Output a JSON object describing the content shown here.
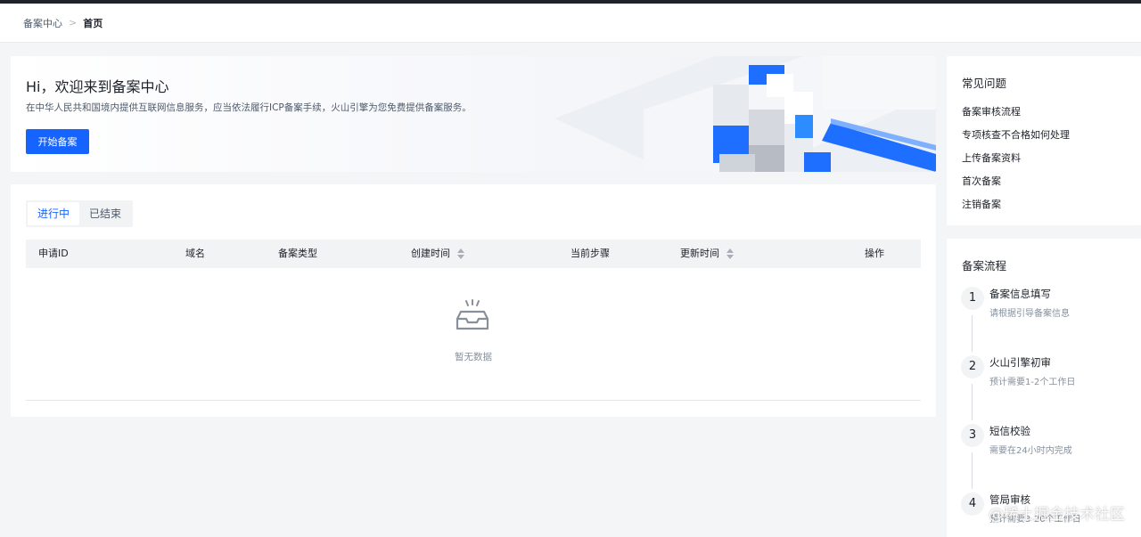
{
  "breadcrumb": {
    "parent": "备案中心",
    "separator": ">",
    "current": "首页"
  },
  "banner": {
    "title": "Hi，欢迎来到备案中心",
    "description": "在中华人民共和国境内提供互联网信息服务，应当依法履行ICP备案手续，火山引擎为您免费提供备案服务。",
    "button_label": "开始备案"
  },
  "records": {
    "tabs": [
      {
        "label": "进行中",
        "active": true
      },
      {
        "label": "已结束",
        "active": false
      }
    ],
    "columns": [
      "申请ID",
      "域名",
      "备案类型",
      "创建时间",
      "当前步骤",
      "更新时间",
      "操作"
    ],
    "empty_text": "暂无数据"
  },
  "faq": {
    "title": "常见问题",
    "items": [
      "备案审核流程",
      "专项核查不合格如何处理",
      "上传备案资料",
      "首次备案",
      "注销备案"
    ]
  },
  "flow": {
    "title": "备案流程",
    "steps": [
      {
        "num": "1",
        "title": "备案信息填写",
        "desc": "请根据引导备案信息"
      },
      {
        "num": "2",
        "title": "火山引擎初审",
        "desc": "预计需要1-2个工作日"
      },
      {
        "num": "3",
        "title": "短信校验",
        "desc": "需要在24小时内完成"
      },
      {
        "num": "4",
        "title": "管局审核",
        "desc": "预计需要3-20个工作日"
      }
    ]
  },
  "watermark": "@稀土掘金技术社区",
  "colors": {
    "primary": "#1664ff",
    "topbar": "#1f2329",
    "page_bg": "#f4f5f7"
  }
}
